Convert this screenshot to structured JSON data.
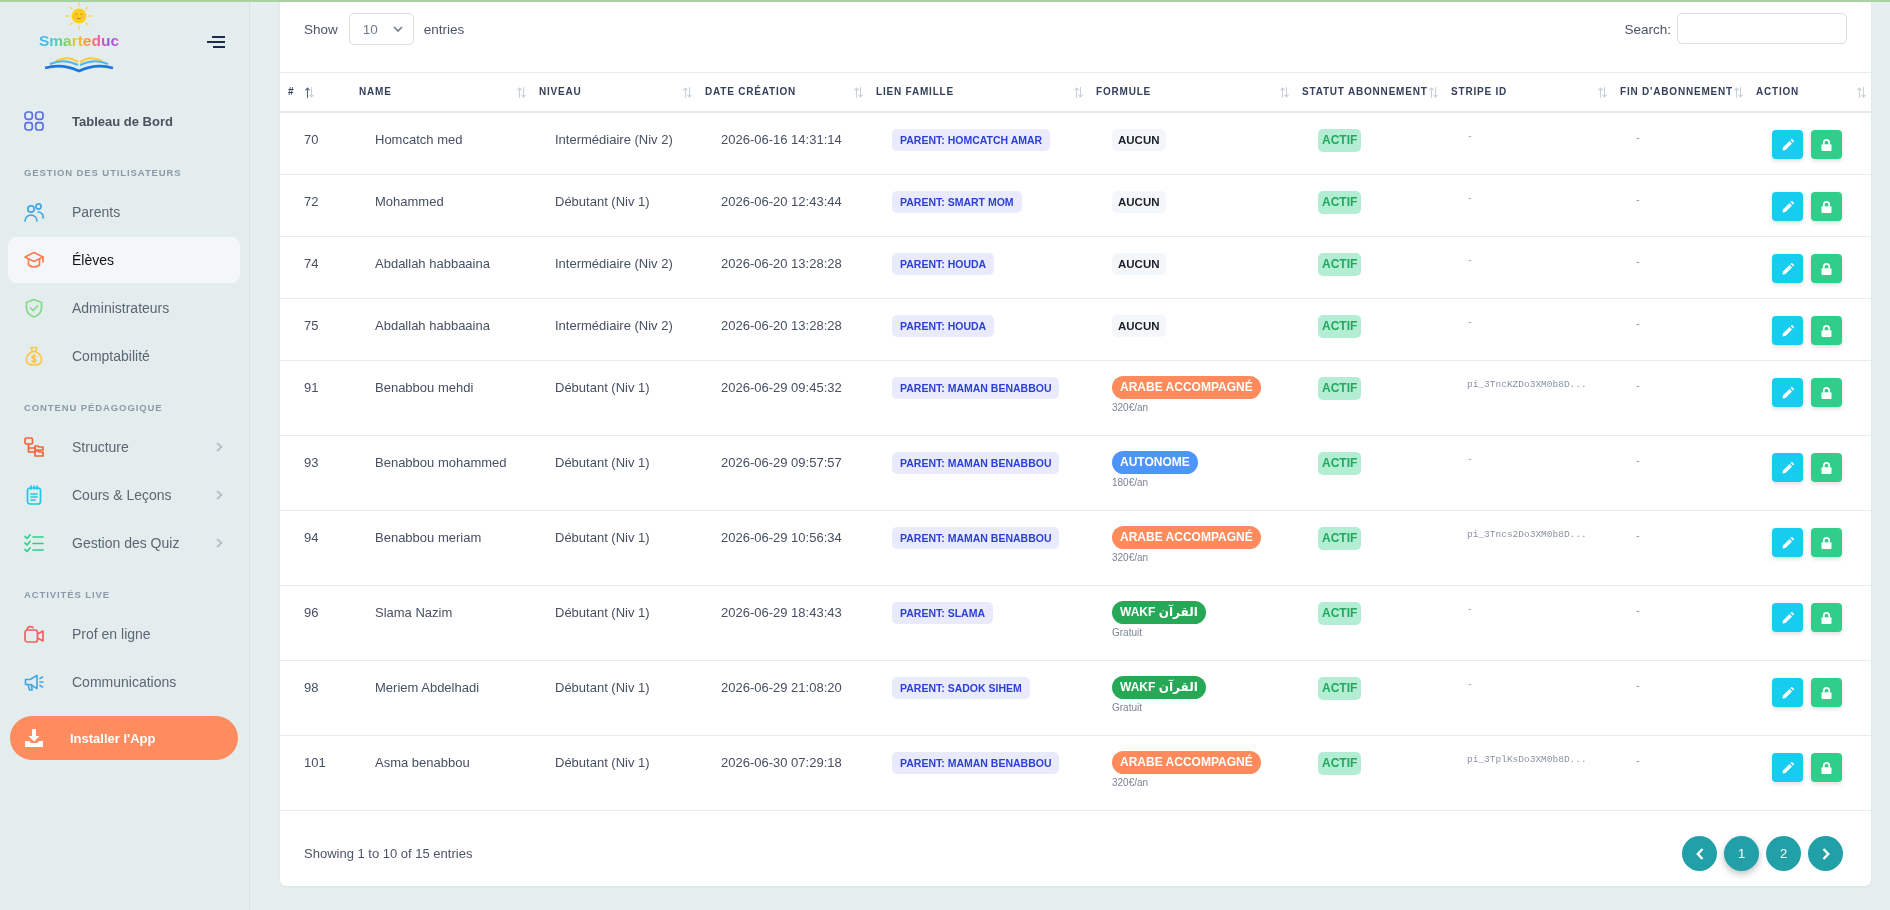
{
  "sidebar": {
    "logo_text": "Smarteduc",
    "nav": [
      {
        "kind": "main",
        "label": "Tableau de Bord",
        "selected": false
      },
      {
        "kind": "heading",
        "label": "GESTION DES UTILISATEURS"
      },
      {
        "kind": "link",
        "label": "Parents",
        "selected": false
      },
      {
        "kind": "link",
        "label": "Élèves",
        "selected": true
      },
      {
        "kind": "link",
        "label": "Administrateurs",
        "selected": false
      },
      {
        "kind": "link",
        "label": "Comptabilité",
        "selected": false
      },
      {
        "kind": "heading",
        "label": "CONTENU PÉDAGOGIQUE"
      },
      {
        "kind": "submenu",
        "label": "Structure",
        "selected": false,
        "expanded": false
      },
      {
        "kind": "submenu",
        "label": "Cours & Leçons",
        "selected": false,
        "expanded": false
      },
      {
        "kind": "submenu",
        "label": "Gestion des Quiz",
        "selected": false,
        "expanded": false
      },
      {
        "kind": "heading",
        "label": "ACTIVITÉS LIVE"
      },
      {
        "kind": "link",
        "label": "Prof en ligne",
        "selected": false
      },
      {
        "kind": "link",
        "label": "Communications",
        "selected": false
      }
    ],
    "install_button": "Installer l'App"
  },
  "table_controls": {
    "length": {
      "before": "Show",
      "value": "10",
      "after": "entries"
    },
    "search": {
      "label": "Search:"
    }
  },
  "table": {
    "columns": [
      {
        "label": "#",
        "sorted": true
      },
      {
        "label": "NAME",
        "sorted": false
      },
      {
        "label": "NIVEAU",
        "sorted": false
      },
      {
        "label": "DATE CRÉATION",
        "sorted": false
      },
      {
        "label": "LIEN FAMILLE",
        "sorted": false
      },
      {
        "label": "FORMULE",
        "sorted": false
      },
      {
        "label": "STATUT ABONNEMENT",
        "sorted": false
      },
      {
        "label": "STRIPE ID",
        "sorted": false
      },
      {
        "label": "FIN D'ABONNEMENT",
        "sorted": false
      },
      {
        "label": "ACTION",
        "sorted": false
      }
    ],
    "rows": [
      {
        "id": "70",
        "name": "Homcatch med",
        "niveau": "Intermédiaire (Niv 2)",
        "date": "2026-06-16 14:31:14",
        "family": "PARENT: HOMCATCH AMAR",
        "formule": {
          "kind": "none",
          "label": "AUCUN"
        },
        "status": "ACTIF",
        "stripe_id": "-",
        "end": "-"
      },
      {
        "id": "72",
        "name": "Mohammed",
        "niveau": "Débutant (Niv 1)",
        "date": "2026-06-20 12:43:44",
        "family": "PARENT: SMART MOM",
        "formule": {
          "kind": "none",
          "label": "AUCUN"
        },
        "status": "ACTIF",
        "stripe_id": "-",
        "end": "-"
      },
      {
        "id": "74",
        "name": "Abdallah habbaaina",
        "niveau": "Intermédiaire (Niv 2)",
        "date": "2026-06-20 13:28:28",
        "family": "PARENT: HOUDA",
        "formule": {
          "kind": "none",
          "label": "AUCUN"
        },
        "status": "ACTIF",
        "stripe_id": "-",
        "end": "-"
      },
      {
        "id": "75",
        "name": "Abdallah habbaaina",
        "niveau": "Intermédiaire (Niv 2)",
        "date": "2026-06-20 13:28:28",
        "family": "PARENT: HOUDA",
        "formule": {
          "kind": "none",
          "label": "AUCUN"
        },
        "status": "ACTIF",
        "stripe_id": "-",
        "end": "-"
      },
      {
        "id": "91",
        "name": "Benabbou mehdi",
        "niveau": "Débutant (Niv 1)",
        "date": "2026-06-29 09:45:32",
        "family": "PARENT: MAMAN BENABBOU",
        "formule": {
          "kind": "plan",
          "label": "ARABE ACCOMPAGNÉ",
          "color": "#ff8a5b",
          "price": "320€/an"
        },
        "status": "ACTIF",
        "stripe_id": "pi_3TncKZDo3XM0b8D...",
        "end": "-"
      },
      {
        "id": "93",
        "name": "Benabbou mohammed",
        "niveau": "Débutant (Niv 1)",
        "date": "2026-06-29 09:57:57",
        "family": "PARENT: MAMAN BENABBOU",
        "formule": {
          "kind": "plan",
          "label": "AUTONOME",
          "color": "#4c95fb",
          "price": "180€/an"
        },
        "status": "ACTIF",
        "stripe_id": "-",
        "end": "-"
      },
      {
        "id": "94",
        "name": "Benabbou meriam",
        "niveau": "Débutant (Niv 1)",
        "date": "2026-06-29 10:56:34",
        "family": "PARENT: MAMAN BENABBOU",
        "formule": {
          "kind": "plan",
          "label": "ARABE ACCOMPAGNÉ",
          "color": "#ff8a5b",
          "price": "320€/an"
        },
        "status": "ACTIF",
        "stripe_id": "pi_3Tncs2Do3XM0b8D...",
        "end": "-"
      },
      {
        "id": "96",
        "name": "Slama Nazim",
        "niveau": "Débutant (Niv 1)",
        "date": "2026-06-29 18:43:43",
        "family": "PARENT: SLAMA",
        "formule": {
          "kind": "plan",
          "label": "WAKF القرآن",
          "color": "#27a857",
          "price": "Gratuit"
        },
        "status": "ACTIF",
        "stripe_id": "-",
        "end": "-"
      },
      {
        "id": "98",
        "name": "Meriem Abdelhadi",
        "niveau": "Débutant (Niv 1)",
        "date": "2026-06-29 21:08:20",
        "family": "PARENT: SADOK SIHEM",
        "formule": {
          "kind": "plan",
          "label": "WAKF القرآن",
          "color": "#27a857",
          "price": "Gratuit"
        },
        "status": "ACTIF",
        "stripe_id": "-",
        "end": "-"
      },
      {
        "id": "101",
        "name": "Asma benabbou",
        "niveau": "Débutant (Niv 1)",
        "date": "2026-06-30 07:29:18",
        "family": "PARENT: MAMAN BENABBOU",
        "formule": {
          "kind": "plan",
          "label": "ARABE ACCOMPAGNÉ",
          "color": "#ff8a5b",
          "price": "320€/an"
        },
        "status": "ACTIF",
        "stripe_id": "pi_3TplKsDo3XM0b8D...",
        "end": "-"
      }
    ]
  },
  "footer": {
    "info": "Showing 1 to 10 of 15 entries",
    "pages": [
      {
        "label": "1",
        "selected": true
      },
      {
        "label": "2",
        "selected": false
      }
    ]
  }
}
